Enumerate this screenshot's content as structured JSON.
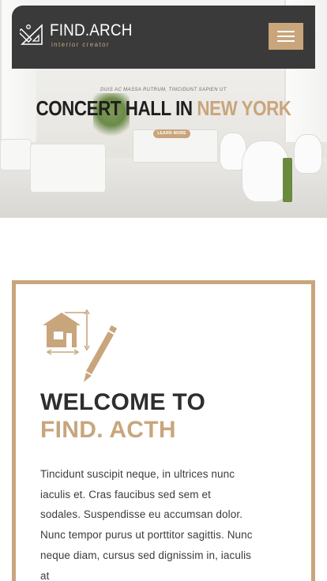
{
  "brand": {
    "name": "FIND.ARCH",
    "tagline": "interior creator"
  },
  "header": {
    "menu_icon": "hamburger-menu-icon"
  },
  "hero": {
    "kicker": "DUIS AC MASSA RUTRUM, TINCIDUNT SAPIEN UT",
    "title_main": "CONCERT HALL IN ",
    "title_accent": "NEW YORK",
    "button_label": "LEARN MORE"
  },
  "welcome": {
    "icon": "house-blueprint-pencil-icon",
    "title_line1": "WELCOME TO",
    "title_line2": "FIND. ACTH",
    "body": "Tincidunt suscipit neque, in ultrices nunc iaculis et. Cras faucibus sed sem et sodales. Suspendisse eu accumsan dolor. Nunc tempor purus ut porttitor sagittis. Nunc neque diam, cursus sed dignissim in, iaculis at"
  },
  "colors": {
    "accent": "#c9a57c",
    "header_bg": "#3a3a3a",
    "heading": "#2e2e2e"
  }
}
